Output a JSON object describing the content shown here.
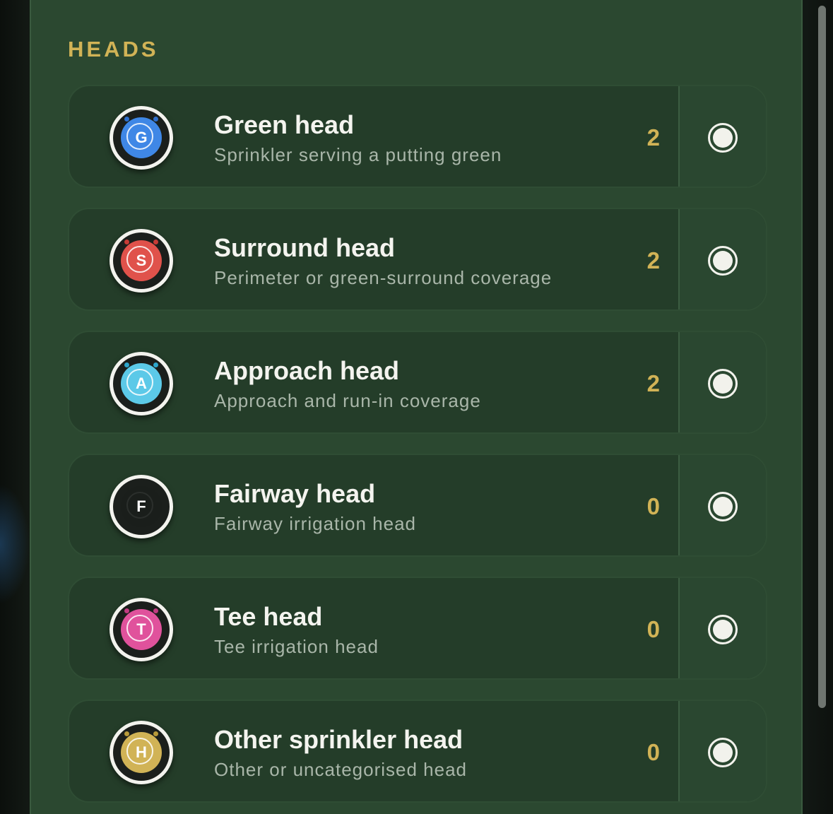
{
  "section": {
    "title": "HEADS"
  },
  "heads": [
    {
      "letter": "G",
      "title": "Green head",
      "subtitle": "Sprinkler serving a putting green",
      "count": "2",
      "color": "#3f87e6",
      "dot": "#2f6fcb",
      "selected": true
    },
    {
      "letter": "S",
      "title": "Surround head",
      "subtitle": "Perimeter or green-surround coverage",
      "count": "2",
      "color": "#e0524b",
      "dot": "#c63b36",
      "selected": true
    },
    {
      "letter": "A",
      "title": "Approach head",
      "subtitle": "Approach and run-in coverage",
      "count": "2",
      "color": "#5cc9e8",
      "dot": "#2ea6cc",
      "selected": true
    },
    {
      "letter": "F",
      "title": "Fairway head",
      "subtitle": "Fairway irrigation head",
      "count": "0",
      "color": "#1a1e1b",
      "dot": "#1a1e1b",
      "selected": true
    },
    {
      "letter": "T",
      "title": "Tee head",
      "subtitle": "Tee irrigation head",
      "count": "0",
      "color": "#e0529c",
      "dot": "#c13b81",
      "selected": true
    },
    {
      "letter": "H",
      "title": "Other sprinkler head",
      "subtitle": "Other or uncategorised head",
      "count": "0",
      "color": "#d1b356",
      "dot": "#b89a3a",
      "selected": true
    }
  ]
}
